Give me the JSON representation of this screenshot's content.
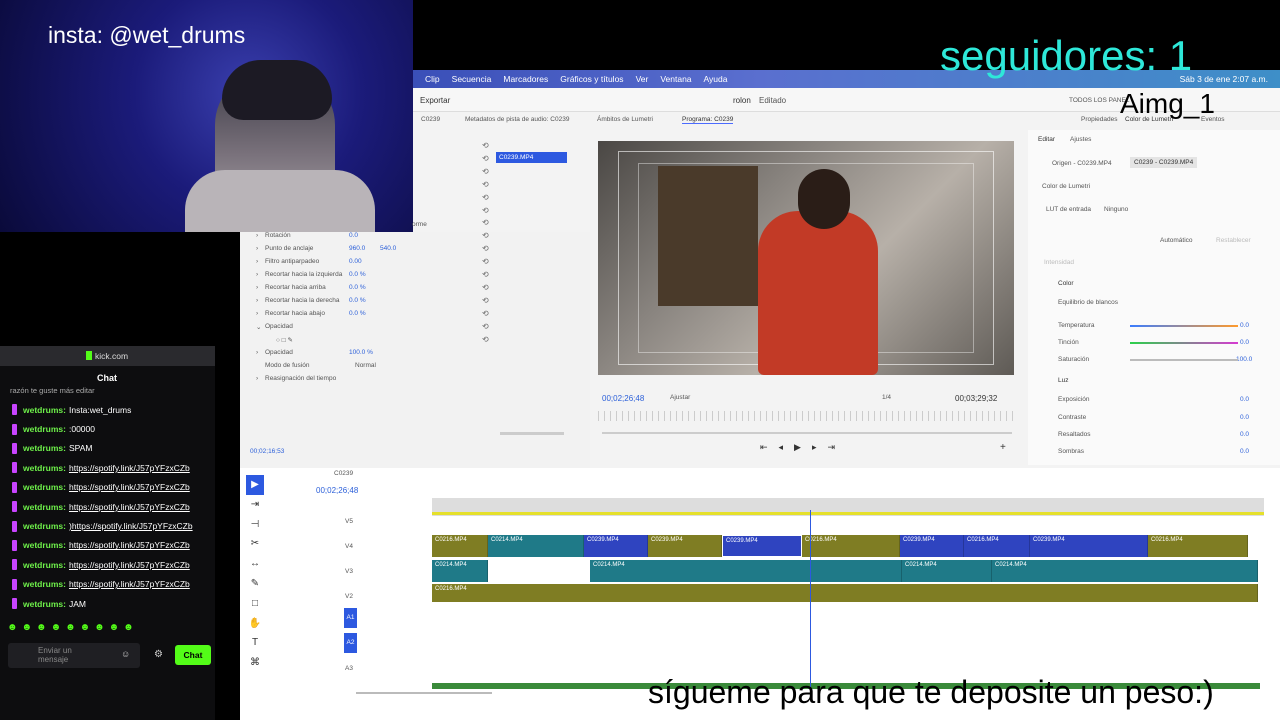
{
  "overlay": {
    "insta": "insta: @wet_drums",
    "followers": "seguidores: 1",
    "aimg": "Aimg_1",
    "subtitle": "sígueme para que te deposite un peso:)"
  },
  "macbar": {
    "menus": [
      "Clip",
      "Secuencia",
      "Marcadores",
      "Gráficos y títulos",
      "Ver",
      "Ventana",
      "Ayuda"
    ],
    "datetime": "Sáb 3 de ene 2:07 a.m."
  },
  "app": {
    "export": "Exportar",
    "project": "rolon",
    "edited": "Editado",
    "workspace": "TODOS LOS PANEL",
    "left_tab": "C0239",
    "meters_tab": "Metadatos de pista de audio: C0239",
    "scopes_tab": "Ámbitos de Lumetri",
    "program_tab": "Programa: C0239",
    "props_tab": "Propiedades",
    "lumetri_tab": "Color de Lumetri",
    "events_tab": "Eventos",
    "clip_name": "C0239.MP4"
  },
  "effects": {
    "items": [
      {
        "label": "Rotación",
        "value": "0.0"
      },
      {
        "label": "Punto de anclaje",
        "value": "960.0",
        "value2": "540.0"
      },
      {
        "label": "Filtro antiparpadeo",
        "value": "0.00"
      },
      {
        "label": "Recortar hacia la izquierda",
        "value": "0.0 %"
      },
      {
        "label": "Recortar hacia arriba",
        "value": "0.0 %"
      },
      {
        "label": "Recortar hacia la derecha",
        "value": "0.0 %"
      },
      {
        "label": "Recortar hacia abajo",
        "value": "0.0 %"
      }
    ],
    "opacity_header": "Opacidad",
    "opacity_label": "Opacidad",
    "opacity_value": "100.0 %",
    "blend_label": "Modo de fusión",
    "blend_value": "Normal",
    "remap": "Reasignación del tiempo",
    "timecode": "00;02;16;53",
    "uniform": "orme"
  },
  "program": {
    "timecode": "00;02;26;48",
    "fit": "Ajustar",
    "quality": "1/4",
    "duration": "00;03;29;32"
  },
  "lumetri": {
    "edit_tab": "Editar",
    "adjust_tab": "Ajustes",
    "source": "Origen - C0239.MP4",
    "target": "C0239 - C0239.MP4",
    "color_label": "Color de Lumetri",
    "lut_label": "LUT de entrada",
    "lut_value": "Ninguno",
    "auto": "Automático",
    "restore": "Restablecer",
    "intensity": "Intensidad",
    "color_section": "Color",
    "wb": "Equilibrio de blancos",
    "sliders": [
      {
        "label": "Temperatura",
        "value": "0.0"
      },
      {
        "label": "Tinción",
        "value": "0.0"
      },
      {
        "label": "Saturación",
        "value": "100.0"
      }
    ],
    "light_section": "Luz",
    "light_sliders": [
      {
        "label": "Exposición",
        "value": "0.0"
      },
      {
        "label": "Contraste",
        "value": "0.0"
      },
      {
        "label": "Resaltados",
        "value": "0.0"
      },
      {
        "label": "Sombras",
        "value": "0.0"
      }
    ]
  },
  "timeline": {
    "seq_name": "C0239",
    "timecode": "00;02;26;48",
    "tracks": [
      "V5",
      "V4",
      "V3",
      "V2",
      "A1",
      "A2",
      "A3"
    ],
    "v4_clips": [
      "C0216.MP4",
      "C0214.MP4",
      "C0239.MP4",
      "C0239.MP4",
      "C0239.MP4",
      "C0216.MP4",
      "C0239.MP4",
      "C0216.MP4",
      "C0239.MP4",
      "C0216.MP4"
    ],
    "v3_clips": [
      "C0214.MP4",
      "C0214.MP4",
      "C0214.MP4",
      "C0214.MP4"
    ],
    "v2_clips": [
      "C0216.MP4"
    ]
  },
  "chat": {
    "url": "kick.com",
    "title": "Chat",
    "partial": "razón te guste más editar",
    "messages": [
      {
        "user": "wetdrums:",
        "text": "Insta:wet_drums",
        "link": false
      },
      {
        "user": "wetdrums:",
        "text": ":00000",
        "link": false
      },
      {
        "user": "wetdrums:",
        "text": "SPAM",
        "link": false
      },
      {
        "user": "wetdrums:",
        "text": "https://spotify.link/J57pYFzxCZb",
        "link": true
      },
      {
        "user": "wetdrums:",
        "text": "https://spotify.link/J57pYFzxCZb",
        "link": true
      },
      {
        "user": "wetdrums:",
        "text": "https://spotify.link/J57pYFzxCZb",
        "link": true
      },
      {
        "user": "wetdrums:",
        "text": ")https://spotify.link/J57pYFzxCZb",
        "link": true
      },
      {
        "user": "wetdrums:",
        "text": "https://spotify.link/J57pYFzxCZb",
        "link": true
      },
      {
        "user": "wetdrums:",
        "text": "https://spotify.link/J57pYFzxCZb",
        "link": true
      },
      {
        "user": "wetdrums:",
        "text": "https://spotify.link/J57pYFzxCZb",
        "link": true
      },
      {
        "user": "wetdrums:",
        "text": "JAM",
        "link": false
      }
    ],
    "input_placeholder": "Enviar un mensaje",
    "send": "Chat"
  }
}
